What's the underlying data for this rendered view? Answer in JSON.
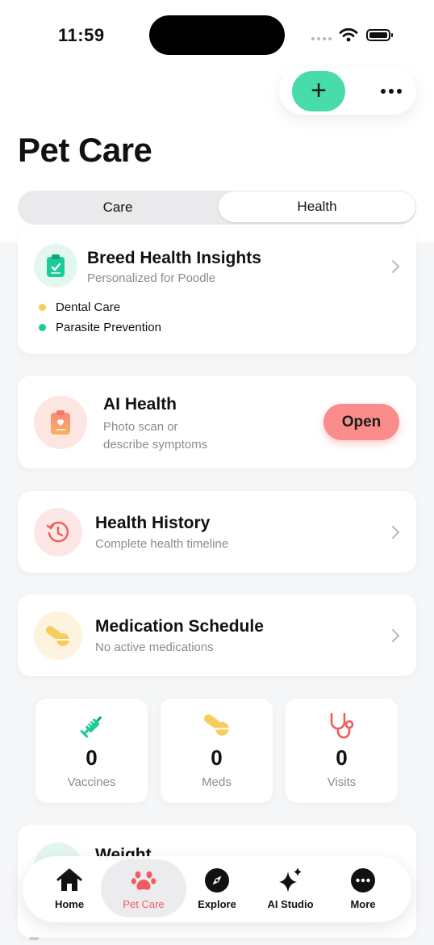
{
  "status_bar": {
    "time": "11:59"
  },
  "header": {
    "title": "Pet Care"
  },
  "segmented": {
    "care": "Care",
    "health": "Health",
    "selected": "Health"
  },
  "breed_card": {
    "title": "Breed Health Insights",
    "subtitle": "Personalized for Poodle",
    "items": [
      {
        "label": "Dental Care",
        "color": "#f8cd5b"
      },
      {
        "label": "Parasite Prevention",
        "color": "#1ccb97"
      }
    ]
  },
  "ai_card": {
    "title": "AI Health",
    "subtitle_line1": "Photo scan or",
    "subtitle_line2": "describe symptoms",
    "button": "Open"
  },
  "history_card": {
    "title": "Health History",
    "subtitle": "Complete health timeline"
  },
  "medication_card": {
    "title": "Medication Schedule",
    "subtitle": "No active medications"
  },
  "stats": [
    {
      "value": "0",
      "label": "Vaccines"
    },
    {
      "value": "0",
      "label": "Meds"
    },
    {
      "value": "0",
      "label": "Visits"
    }
  ],
  "weight_card": {
    "title": "Weight"
  },
  "tabbar": {
    "home": "Home",
    "pet_care": "Pet Care",
    "explore": "Explore",
    "ai_studio": "AI Studio",
    "more": "More",
    "active": "Pet Care"
  },
  "colors": {
    "accent_green": "#48dbab",
    "accent_red": "#f25b5b",
    "open_button": "#fb8c8c",
    "medication_yellow": "#f8cd5b"
  }
}
